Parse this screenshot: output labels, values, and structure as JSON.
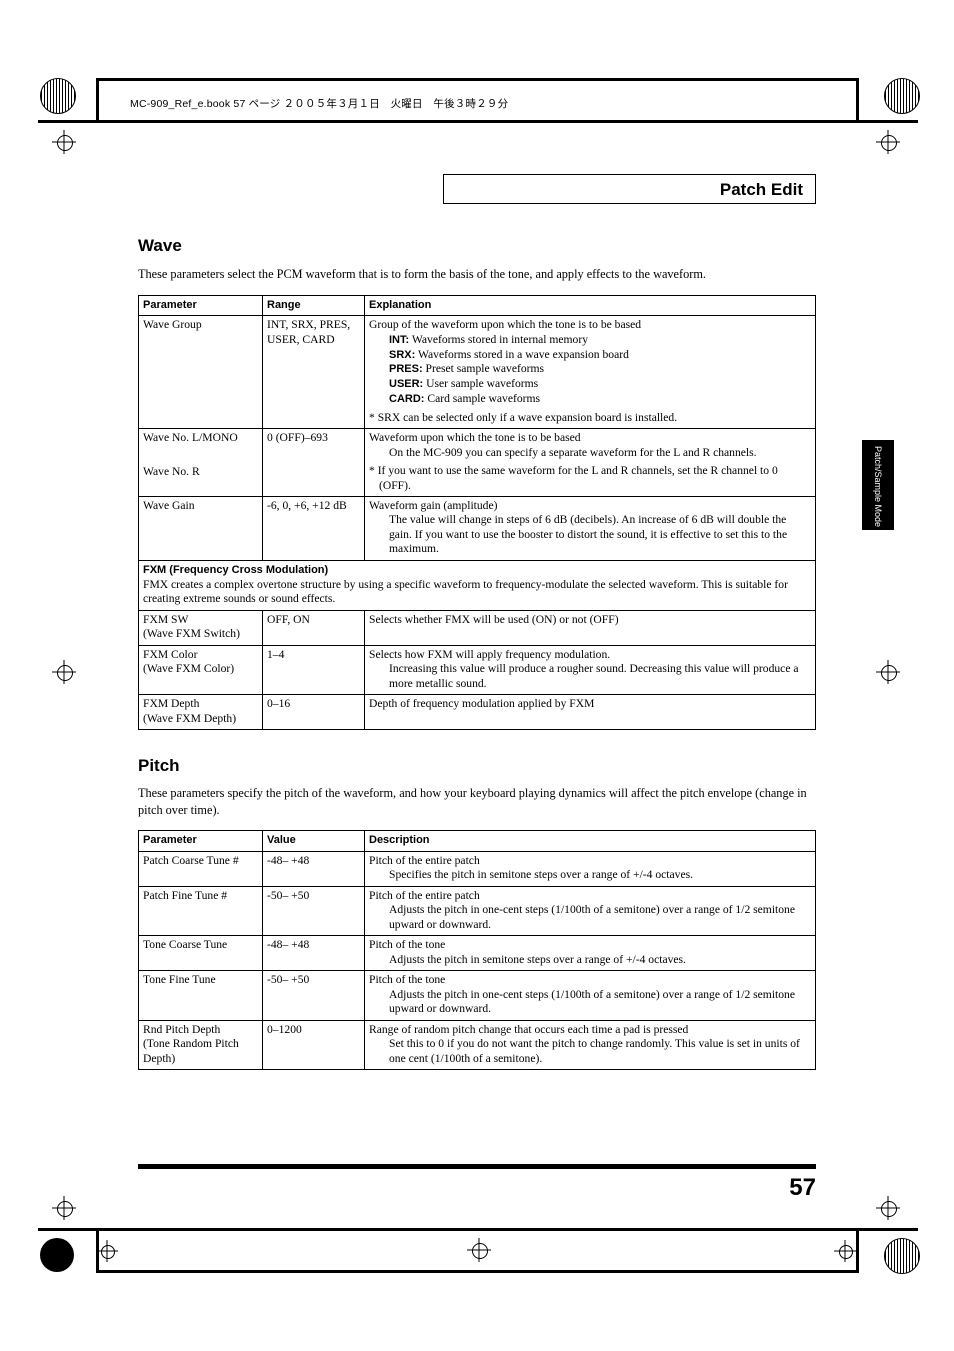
{
  "header": {
    "file_stamp": "MC-909_Ref_e.book 57 ページ ２００５年３月１日　火曜日　午後３時２９分",
    "running_head": "Patch Edit"
  },
  "side_tab": {
    "label": "Patch/Sample Mode"
  },
  "sections": [
    {
      "title": "Wave",
      "intro": "These parameters select the PCM waveform that is to form the basis of the tone, and apply effects to the waveform.",
      "columns": [
        "Parameter",
        "Range",
        "Explanation"
      ],
      "rows": [
        {
          "parameter": "Wave Group",
          "range": "INT, SRX, PRES, USER, CARD",
          "explanation_main": "Group of the waveform upon which the tone is to be based",
          "explanation_defs": [
            {
              "term": "INT:",
              "text": "Waveforms stored in internal memory"
            },
            {
              "term": "SRX:",
              "text": "Waveforms stored in a wave expansion board"
            },
            {
              "term": "PRES:",
              "text": "Preset sample waveforms"
            },
            {
              "term": "USER:",
              "text": "User sample waveforms"
            },
            {
              "term": "CARD:",
              "text": "Card sample waveforms"
            }
          ],
          "note": "* SRX can be selected only if a wave expansion board is installed."
        },
        {
          "parameter": "Wave No. L/MONO",
          "parameter2": "Wave No. R",
          "range": "0 (OFF)–693",
          "explanation_main": "Waveform upon which the tone is to be based",
          "explanation_sub": "On the MC-909 you can specify a separate waveform for the L and R channels.",
          "note": "* If you want to use the same waveform for the L and R channels, set the R channel to 0 (OFF)."
        },
        {
          "parameter": "Wave Gain",
          "range": "-6, 0, +6, +12 dB",
          "explanation_main": "Waveform gain (amplitude)",
          "explanation_sub": "The value will change in steps of 6 dB (decibels). An increase of 6 dB will double the gain. If you want to use the booster to distort the sound, it is effective to set this to the maximum."
        }
      ],
      "fxm_heading": "FXM (Frequency Cross Modulation)",
      "fxm_text": "FMX creates a complex overtone structure by using a specific waveform to frequency-modulate the selected waveform. This is suitable for creating extreme sounds or sound effects.",
      "rows2": [
        {
          "parameter": "FXM SW",
          "parameter2": "(Wave FXM Switch)",
          "range": "OFF, ON",
          "explanation_main": "Selects whether FMX will be used (ON) or not (OFF)"
        },
        {
          "parameter": "FXM Color",
          "parameter2": "(Wave FXM Color)",
          "range": "1–4",
          "explanation_main": "Selects how FXM will apply frequency modulation.",
          "explanation_sub": "Increasing this value will produce a rougher sound. Decreasing this value will produce a more metallic sound."
        },
        {
          "parameter": "FXM Depth",
          "parameter2": "(Wave FXM Depth)",
          "range": "0–16",
          "explanation_main": "Depth of frequency modulation applied by FXM"
        }
      ]
    },
    {
      "title": "Pitch",
      "intro": "These parameters specify the pitch of the waveform, and how your keyboard playing dynamics will affect the pitch envelope (change in pitch over time).",
      "columns": [
        "Parameter",
        "Value",
        "Description"
      ],
      "rows": [
        {
          "parameter": "Patch Coarse Tune #",
          "range": "-48– +48",
          "explanation_main": "Pitch of the entire patch",
          "explanation_sub": "Specifies the pitch in semitone steps over a range of +/-4 octaves."
        },
        {
          "parameter": "Patch Fine Tune #",
          "range": "-50– +50",
          "explanation_main": "Pitch of the entire patch",
          "explanation_sub": "Adjusts the pitch in one-cent steps (1/100th of a semitone) over a range of 1/2 semitone upward or downward."
        },
        {
          "parameter": "Tone Coarse Tune",
          "range": "-48– +48",
          "explanation_main": "Pitch of the tone",
          "explanation_sub": "Adjusts the pitch in semitone steps over a range of +/-4 octaves."
        },
        {
          "parameter": "Tone Fine Tune",
          "range": "-50– +50",
          "explanation_main": "Pitch of the tone",
          "explanation_sub": "Adjusts the pitch in one-cent steps (1/100th of a semitone) over a range of 1/2 semitone upward or downward."
        },
        {
          "parameter": "Rnd Pitch Depth",
          "parameter2": "(Tone Random Pitch",
          "parameter3": "Depth)",
          "range": "0–1200",
          "explanation_main": "Range of random pitch change that occurs each time a pad is pressed",
          "explanation_sub": "Set this to 0 if you do not want the pitch to change randomly. This value is set in units of one cent (1/100th of a semitone)."
        }
      ]
    }
  ],
  "footer": {
    "page_number": "57"
  }
}
